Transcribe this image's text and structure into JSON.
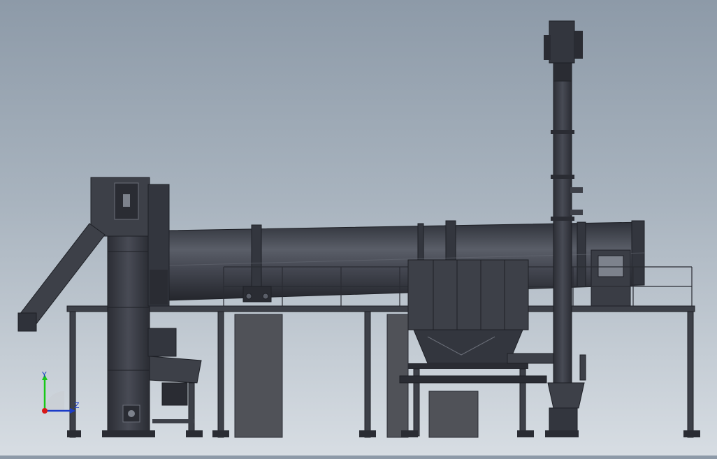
{
  "viewport": {
    "name": "3D model view",
    "background_top": "#8d9aa8",
    "background_bottom": "#d7dde3"
  },
  "triad": {
    "y_label": "Y",
    "z_label": "Z",
    "y_color": "#18c818",
    "z_color": "#1c3cc8",
    "x_color": "#d81818"
  },
  "model": {
    "metal_color": "#3d4048",
    "dark_color": "#2a2c33",
    "panel_color": "#505258"
  }
}
